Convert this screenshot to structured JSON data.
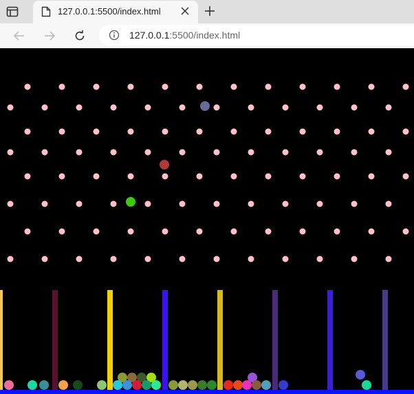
{
  "browser": {
    "tab_title": "127.0.0.1:5500/index.html",
    "url_host": "127.0.0.1",
    "url_rest": ":5500/index.html"
  },
  "colors": {
    "peg": "#ffc0cb",
    "floor": "#0f12ff",
    "background": "#000000"
  },
  "board": {
    "walls": [
      {
        "color": "#f2c94c"
      },
      {
        "color": "#5a1030"
      },
      {
        "color": "#f5d000"
      },
      {
        "color": "#3a12ee"
      },
      {
        "color": "#d9b81a"
      },
      {
        "color": "#4a2a7a"
      },
      {
        "color": "#3a1ed8"
      },
      {
        "color": "#4a3a8a"
      }
    ],
    "falling_balls": [
      {
        "color": "#6a6a9a"
      },
      {
        "color": "#b03a3a"
      },
      {
        "color": "#3ec90e"
      }
    ],
    "settled_balls": [
      {
        "color": "#ea6d9a"
      },
      {
        "color": "#1fd8a0"
      },
      {
        "color": "#3a8e96"
      },
      {
        "color": "#f2a24a"
      },
      {
        "color": "#164a1c"
      },
      {
        "color": "#8ec86e"
      },
      {
        "color": "#8e9a32"
      },
      {
        "color": "#8a6a3a"
      },
      {
        "color": "#3a5a2a"
      },
      {
        "color": "#a0e018"
      },
      {
        "color": "#28c8d8"
      },
      {
        "color": "#3a92d8"
      },
      {
        "color": "#d81a3a"
      },
      {
        "color": "#1a9a6a"
      },
      {
        "color": "#30e890"
      },
      {
        "color": "#8a9a3a"
      },
      {
        "color": "#b4b46e"
      },
      {
        "color": "#9a9a4a"
      },
      {
        "color": "#3a7a2a"
      },
      {
        "color": "#2a8a2a"
      },
      {
        "color": "#e82a1a"
      },
      {
        "color": "#e84a1a"
      },
      {
        "color": "#e832b8"
      },
      {
        "color": "#9a52d8"
      },
      {
        "color": "#8a5a3a"
      },
      {
        "color": "#52a0b8"
      },
      {
        "color": "#3a3ad0"
      },
      {
        "color": "#5a5ad8"
      },
      {
        "color": "#18d89a"
      }
    ]
  }
}
